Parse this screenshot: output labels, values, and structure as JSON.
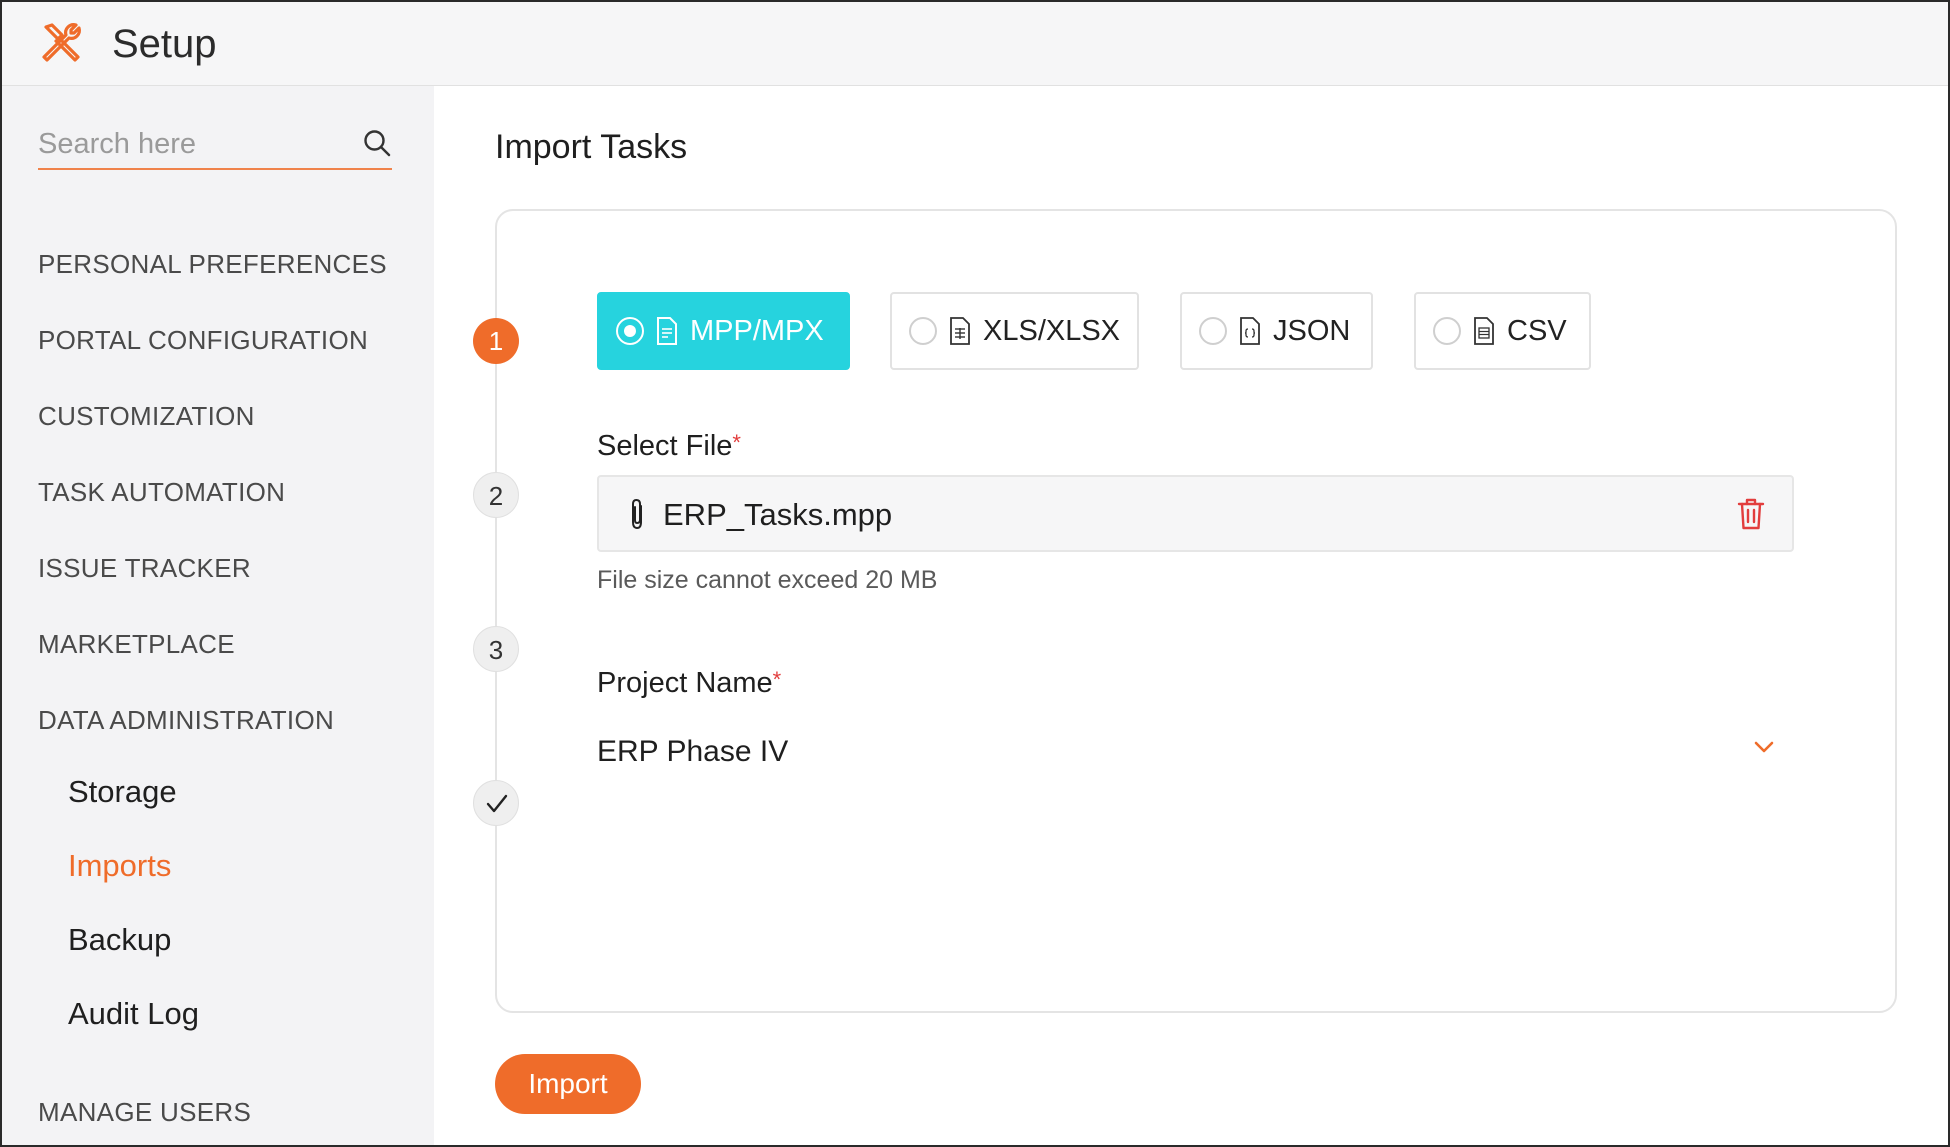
{
  "header": {
    "title": "Setup",
    "logo_icon": "tools-icon"
  },
  "sidebar": {
    "search_placeholder": "Search here",
    "sections": [
      "PERSONAL PREFERENCES",
      "PORTAL CONFIGURATION",
      "CUSTOMIZATION",
      "TASK AUTOMATION",
      "ISSUE TRACKER",
      "MARKETPLACE",
      "DATA ADMINISTRATION"
    ],
    "data_admin_items": [
      "Storage",
      "Imports",
      "Backup",
      "Audit Log"
    ],
    "active_item": "Imports",
    "manage_users": "MANAGE USERS"
  },
  "main": {
    "title": "Import Tasks",
    "steps": [
      "1",
      "2",
      "3"
    ],
    "formats": [
      {
        "label": "MPP/MPX",
        "selected": true
      },
      {
        "label": "XLS/XLSX",
        "selected": false
      },
      {
        "label": "JSON",
        "selected": false
      },
      {
        "label": "CSV",
        "selected": false
      }
    ],
    "select_file": {
      "label": "Select File",
      "required_mark": "*",
      "file_name": "ERP_Tasks.mpp",
      "hint": "File size cannot exceed 20 MB"
    },
    "project": {
      "label": "Project Name",
      "required_mark": "*",
      "value": "ERP Phase IV"
    },
    "import_button": "Import"
  },
  "colors": {
    "accent": "#ef6c2a",
    "selected_format": "#26d3de",
    "required": "#e23d3d"
  }
}
